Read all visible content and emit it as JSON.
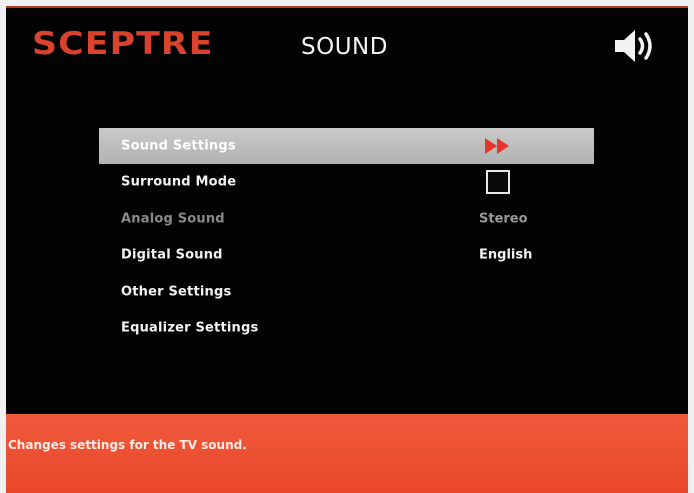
{
  "header": {
    "brand": "SCEPTRE",
    "title": "SOUND",
    "speaker_icon": "speaker-volume-icon"
  },
  "menu": {
    "items": [
      {
        "label": "Sound Settings",
        "value": "",
        "control": "arrow",
        "state": "selected"
      },
      {
        "label": "Surround Mode",
        "value": "",
        "control": "checkbox",
        "checked": false,
        "state": "normal"
      },
      {
        "label": "Analog Sound",
        "value": "Stereo",
        "control": "value",
        "state": "disabled"
      },
      {
        "label": "Digital Sound",
        "value": "English",
        "control": "value",
        "state": "normal"
      },
      {
        "label": "Other Settings",
        "value": "",
        "control": "none",
        "state": "normal"
      },
      {
        "label": "Equalizer Settings",
        "value": "",
        "control": "none",
        "state": "normal"
      }
    ]
  },
  "footer": {
    "help_text": "Changes settings for the TV sound."
  },
  "colors": {
    "brand": "#d9432d",
    "footer": "#ee5234",
    "selection": "#bfbfbf",
    "arrow": "#e8342a"
  }
}
